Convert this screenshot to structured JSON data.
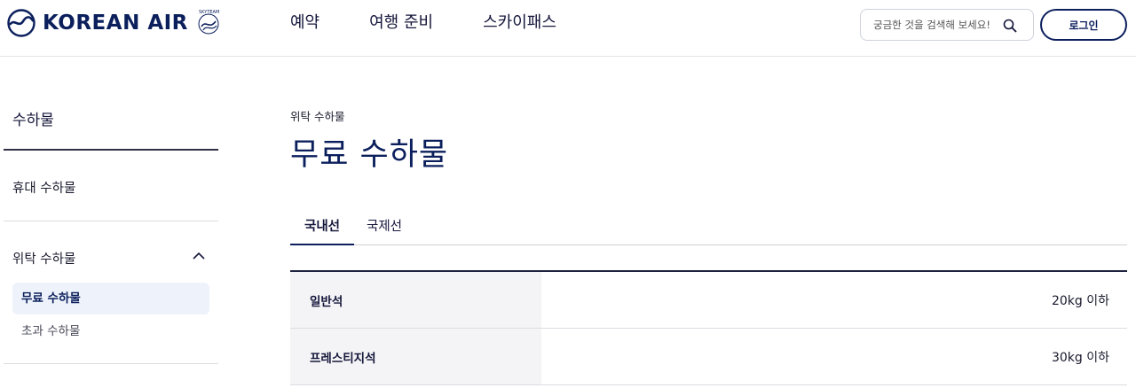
{
  "header": {
    "logo_text": "KOREAN AIR",
    "alliance_text": "SKYTEAM",
    "nav": [
      "예약",
      "여행 준비",
      "스카이패스"
    ],
    "search_placeholder": "궁금한 것을 검색해 보세요!",
    "login_label": "로그인"
  },
  "sidebar": {
    "title": "수하물",
    "items": [
      {
        "label": "휴대 수하물",
        "expanded": false
      },
      {
        "label": "위탁 수하물",
        "expanded": true,
        "children": [
          {
            "label": "무료 수하물",
            "active": true
          },
          {
            "label": "초과 수하물",
            "active": false
          }
        ]
      }
    ]
  },
  "main": {
    "breadcrumb": "위탁 수하물",
    "title": "무료 수하물",
    "tabs": [
      {
        "label": "국내선",
        "active": true
      },
      {
        "label": "국제선",
        "active": false
      }
    ],
    "table": [
      {
        "class": "일반석",
        "allowance": "20kg 이하"
      },
      {
        "class": "프레스티지석",
        "allowance": "30kg 이하"
      }
    ]
  },
  "colors": {
    "brand_navy": "#0b1f5c",
    "active_bg": "#eef3fb",
    "table_header_bg": "#f4f4f6"
  }
}
